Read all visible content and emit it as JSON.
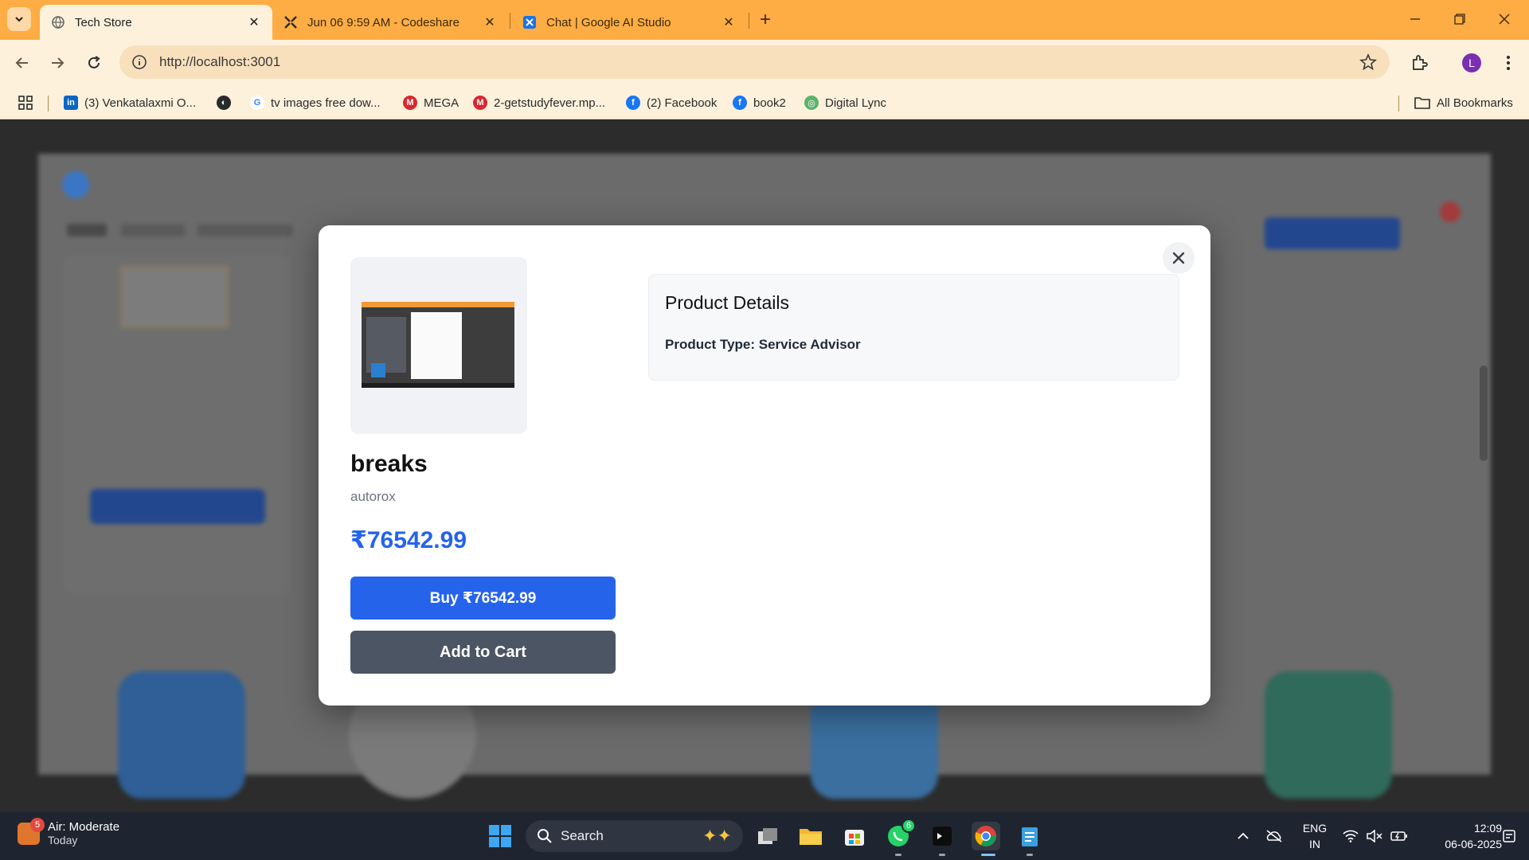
{
  "browser": {
    "tabs": [
      {
        "title": "Tech Store",
        "active": true
      },
      {
        "title": "Jun 06 9:59 AM - Codeshare",
        "active": false
      },
      {
        "title": "Chat | Google AI Studio",
        "active": false
      }
    ],
    "url": "http://localhost:3001",
    "profile_initial": "L",
    "bookmarks": [
      {
        "label": "(3) Venkatalaxmi O..."
      },
      {
        "label": ""
      },
      {
        "label": "tv images free dow..."
      },
      {
        "label": "MEGA"
      },
      {
        "label": "2-getstudyfever.mp..."
      },
      {
        "label": "(2) Facebook"
      },
      {
        "label": "book2"
      },
      {
        "label": "Digital Lync"
      }
    ],
    "all_bookmarks_label": "All Bookmarks"
  },
  "modal": {
    "product_name": "breaks",
    "vendor": "autorox",
    "price": "₹76542.99",
    "buy_label": "Buy ₹76542.99",
    "cart_label": "Add to Cart",
    "details_title": "Product Details",
    "details_type_label": "Product Type:",
    "details_type_value": "Service Advisor"
  },
  "taskbar": {
    "weather_title": "Air: Moderate",
    "weather_sub": "Today",
    "weather_badge": "5",
    "search_label": "Search",
    "whatsapp_badge": "6",
    "lang_line1": "ENG",
    "lang_line2": "IN",
    "time": "12:09",
    "date": "06-06-2025"
  },
  "colors": {
    "tabstrip": "#fdad43",
    "toolbar": "#fef1dc",
    "primary_blue": "#2563eb",
    "cart_gray": "#4b5563"
  }
}
